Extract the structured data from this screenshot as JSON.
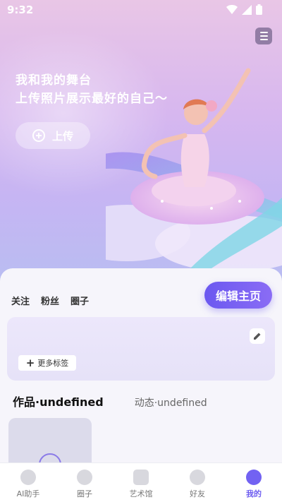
{
  "status": {
    "time": "9:32"
  },
  "hero": {
    "line1": "我和我的舞台",
    "line2": "上传照片展示最好的自己～",
    "upload_label": "上传"
  },
  "profile": {
    "links": [
      "关注",
      "粉丝",
      "圈子"
    ],
    "edit_label": "编辑主页",
    "more_tags_label": "更多标签"
  },
  "tabs": {
    "works": "作品·undefined",
    "moments": "动态·undefined"
  },
  "nav": [
    {
      "label": "AI助手",
      "icon": "ai-assistant-icon"
    },
    {
      "label": "圈子",
      "icon": "circle-icon"
    },
    {
      "label": "艺术馆",
      "icon": "gallery-icon"
    },
    {
      "label": "好友",
      "icon": "friends-icon"
    },
    {
      "label": "我的",
      "icon": "me-icon",
      "active": true
    }
  ],
  "colors": {
    "accent": "#6d5cf0",
    "hero_top": "#e9c6e6",
    "hero_bottom": "#b9bdf2"
  }
}
